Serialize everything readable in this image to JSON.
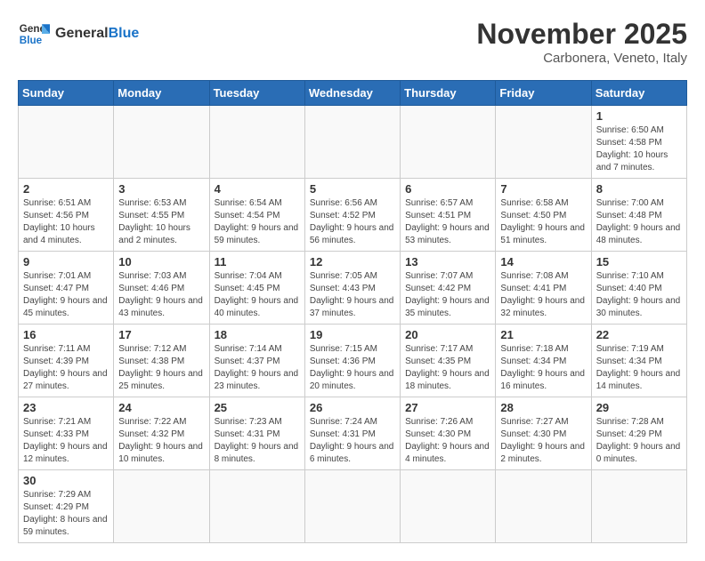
{
  "logo": {
    "text_general": "General",
    "text_blue": "Blue"
  },
  "title": "November 2025",
  "location": "Carbonera, Veneto, Italy",
  "days_header": [
    "Sunday",
    "Monday",
    "Tuesday",
    "Wednesday",
    "Thursday",
    "Friday",
    "Saturday"
  ],
  "weeks": [
    [
      {
        "day": "",
        "info": ""
      },
      {
        "day": "",
        "info": ""
      },
      {
        "day": "",
        "info": ""
      },
      {
        "day": "",
        "info": ""
      },
      {
        "day": "",
        "info": ""
      },
      {
        "day": "",
        "info": ""
      },
      {
        "day": "1",
        "info": "Sunrise: 6:50 AM\nSunset: 4:58 PM\nDaylight: 10 hours and 7 minutes."
      }
    ],
    [
      {
        "day": "2",
        "info": "Sunrise: 6:51 AM\nSunset: 4:56 PM\nDaylight: 10 hours and 4 minutes."
      },
      {
        "day": "3",
        "info": "Sunrise: 6:53 AM\nSunset: 4:55 PM\nDaylight: 10 hours and 2 minutes."
      },
      {
        "day": "4",
        "info": "Sunrise: 6:54 AM\nSunset: 4:54 PM\nDaylight: 9 hours and 59 minutes."
      },
      {
        "day": "5",
        "info": "Sunrise: 6:56 AM\nSunset: 4:52 PM\nDaylight: 9 hours and 56 minutes."
      },
      {
        "day": "6",
        "info": "Sunrise: 6:57 AM\nSunset: 4:51 PM\nDaylight: 9 hours and 53 minutes."
      },
      {
        "day": "7",
        "info": "Sunrise: 6:58 AM\nSunset: 4:50 PM\nDaylight: 9 hours and 51 minutes."
      },
      {
        "day": "8",
        "info": "Sunrise: 7:00 AM\nSunset: 4:48 PM\nDaylight: 9 hours and 48 minutes."
      }
    ],
    [
      {
        "day": "9",
        "info": "Sunrise: 7:01 AM\nSunset: 4:47 PM\nDaylight: 9 hours and 45 minutes."
      },
      {
        "day": "10",
        "info": "Sunrise: 7:03 AM\nSunset: 4:46 PM\nDaylight: 9 hours and 43 minutes."
      },
      {
        "day": "11",
        "info": "Sunrise: 7:04 AM\nSunset: 4:45 PM\nDaylight: 9 hours and 40 minutes."
      },
      {
        "day": "12",
        "info": "Sunrise: 7:05 AM\nSunset: 4:43 PM\nDaylight: 9 hours and 37 minutes."
      },
      {
        "day": "13",
        "info": "Sunrise: 7:07 AM\nSunset: 4:42 PM\nDaylight: 9 hours and 35 minutes."
      },
      {
        "day": "14",
        "info": "Sunrise: 7:08 AM\nSunset: 4:41 PM\nDaylight: 9 hours and 32 minutes."
      },
      {
        "day": "15",
        "info": "Sunrise: 7:10 AM\nSunset: 4:40 PM\nDaylight: 9 hours and 30 minutes."
      }
    ],
    [
      {
        "day": "16",
        "info": "Sunrise: 7:11 AM\nSunset: 4:39 PM\nDaylight: 9 hours and 27 minutes."
      },
      {
        "day": "17",
        "info": "Sunrise: 7:12 AM\nSunset: 4:38 PM\nDaylight: 9 hours and 25 minutes."
      },
      {
        "day": "18",
        "info": "Sunrise: 7:14 AM\nSunset: 4:37 PM\nDaylight: 9 hours and 23 minutes."
      },
      {
        "day": "19",
        "info": "Sunrise: 7:15 AM\nSunset: 4:36 PM\nDaylight: 9 hours and 20 minutes."
      },
      {
        "day": "20",
        "info": "Sunrise: 7:17 AM\nSunset: 4:35 PM\nDaylight: 9 hours and 18 minutes."
      },
      {
        "day": "21",
        "info": "Sunrise: 7:18 AM\nSunset: 4:34 PM\nDaylight: 9 hours and 16 minutes."
      },
      {
        "day": "22",
        "info": "Sunrise: 7:19 AM\nSunset: 4:34 PM\nDaylight: 9 hours and 14 minutes."
      }
    ],
    [
      {
        "day": "23",
        "info": "Sunrise: 7:21 AM\nSunset: 4:33 PM\nDaylight: 9 hours and 12 minutes."
      },
      {
        "day": "24",
        "info": "Sunrise: 7:22 AM\nSunset: 4:32 PM\nDaylight: 9 hours and 10 minutes."
      },
      {
        "day": "25",
        "info": "Sunrise: 7:23 AM\nSunset: 4:31 PM\nDaylight: 9 hours and 8 minutes."
      },
      {
        "day": "26",
        "info": "Sunrise: 7:24 AM\nSunset: 4:31 PM\nDaylight: 9 hours and 6 minutes."
      },
      {
        "day": "27",
        "info": "Sunrise: 7:26 AM\nSunset: 4:30 PM\nDaylight: 9 hours and 4 minutes."
      },
      {
        "day": "28",
        "info": "Sunrise: 7:27 AM\nSunset: 4:30 PM\nDaylight: 9 hours and 2 minutes."
      },
      {
        "day": "29",
        "info": "Sunrise: 7:28 AM\nSunset: 4:29 PM\nDaylight: 9 hours and 0 minutes."
      }
    ],
    [
      {
        "day": "30",
        "info": "Sunrise: 7:29 AM\nSunset: 4:29 PM\nDaylight: 8 hours and 59 minutes."
      },
      {
        "day": "",
        "info": ""
      },
      {
        "day": "",
        "info": ""
      },
      {
        "day": "",
        "info": ""
      },
      {
        "day": "",
        "info": ""
      },
      {
        "day": "",
        "info": ""
      },
      {
        "day": "",
        "info": ""
      }
    ]
  ]
}
